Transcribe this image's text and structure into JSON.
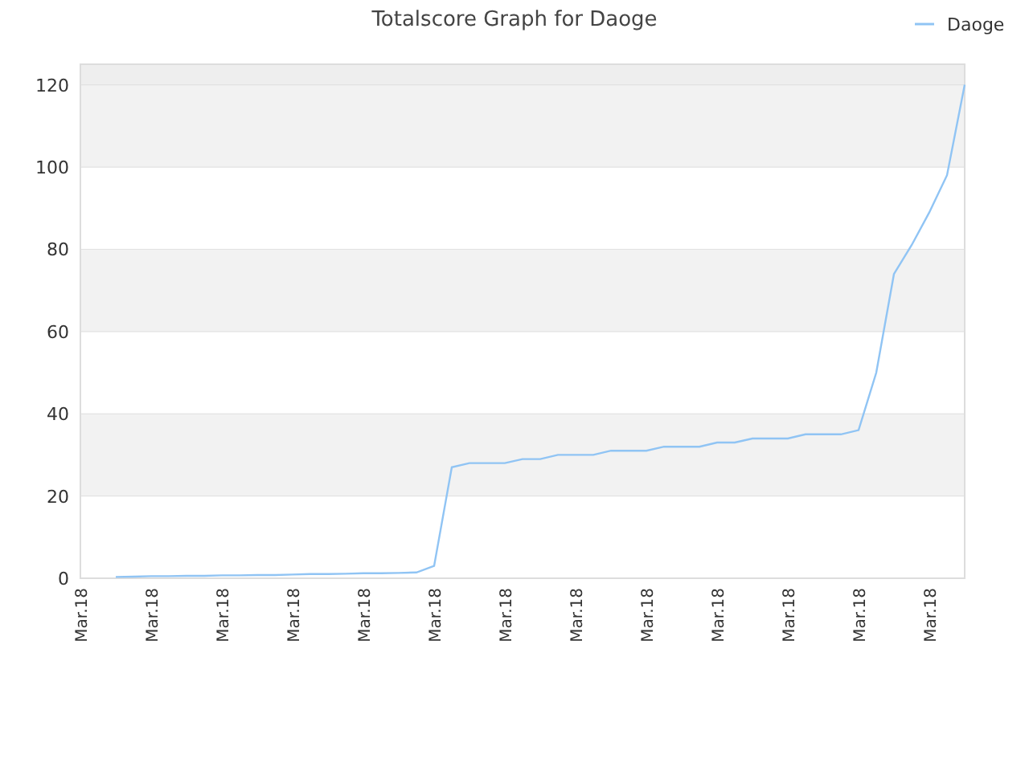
{
  "chart_data": {
    "type": "line",
    "title": "Totalscore Graph for Daoge",
    "categories": [
      "Mar.18",
      null,
      null,
      null,
      "Mar.18",
      null,
      null,
      null,
      "Mar.18",
      null,
      null,
      null,
      "Mar.18",
      null,
      null,
      null,
      "Mar.18",
      null,
      null,
      null,
      "Mar.18",
      null,
      null,
      null,
      "Mar.18",
      null,
      null,
      null,
      "Mar.18",
      null,
      null,
      null,
      "Mar.18",
      null,
      null,
      null,
      "Mar.18",
      null,
      null,
      null,
      "Mar.18",
      null,
      null,
      null,
      "Mar.18",
      null,
      null,
      null,
      "Mar.18",
      null,
      null
    ],
    "series": [
      {
        "name": "Daoge",
        "color": "#90c4f4",
        "values": [
          null,
          null,
          0.3,
          0.4,
          0.5,
          0.5,
          0.6,
          0.6,
          0.7,
          0.7,
          0.8,
          0.8,
          0.9,
          1,
          1,
          1.1,
          1.2,
          1.2,
          1.3,
          1.4,
          3,
          27,
          28,
          28,
          28,
          29,
          29,
          30,
          30,
          30,
          31,
          31,
          31,
          32,
          32,
          32,
          33,
          33,
          34,
          34,
          34,
          35,
          35,
          35,
          36,
          50,
          74,
          81,
          89,
          98,
          120
        ]
      }
    ],
    "ylim": [
      0,
      125
    ],
    "yticks": [
      0,
      20,
      40,
      60,
      80,
      100,
      120
    ]
  }
}
